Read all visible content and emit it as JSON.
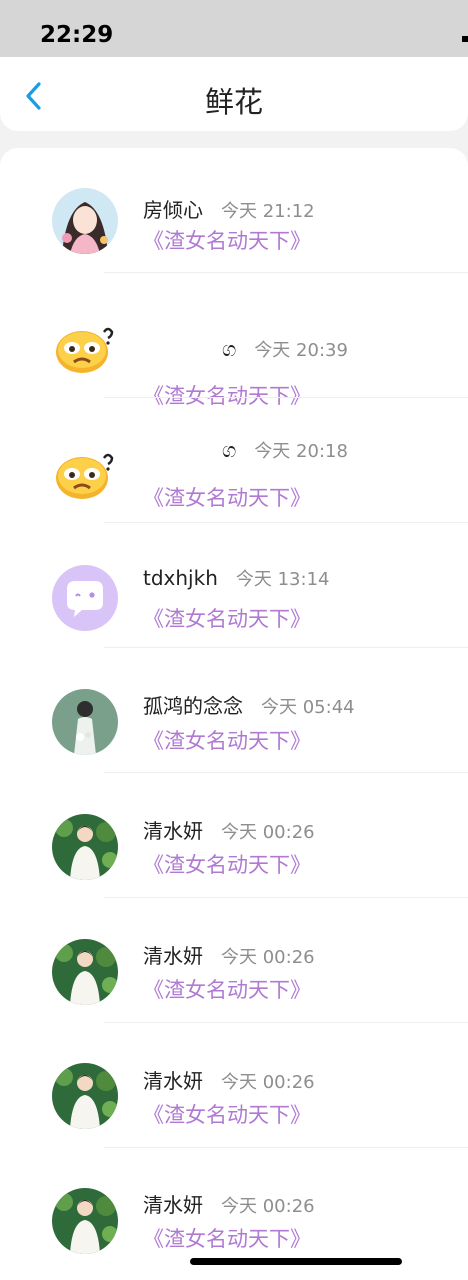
{
  "status": {
    "time": "22:29"
  },
  "nav": {
    "title": "鲜花",
    "back_icon": "chevron-left-icon"
  },
  "list": [
    {
      "name": "房倾心",
      "time": "今天 21:12",
      "book": "《渣女名动天下》",
      "avatar": "girl-illustration"
    },
    {
      "name": "ග",
      "time": "今天 20:39",
      "book": "《渣女名动天下》",
      "avatar": "crying-emoji"
    },
    {
      "name": "ග",
      "time": "今天 20:18",
      "book": "《渣女名动天下》",
      "avatar": "crying-emoji"
    },
    {
      "name": "tdxhjkh",
      "time": "今天 13:14",
      "book": "《渣女名动天下》",
      "avatar": "default-chat-avatar"
    },
    {
      "name": "孤鸿的念念",
      "time": "今天 05:44",
      "book": "《渣女名动天下》",
      "avatar": "bride-photo"
    },
    {
      "name": "清水妍",
      "time": "今天 00:26",
      "book": "《渣女名动天下》",
      "avatar": "man-in-forest"
    },
    {
      "name": "清水妍",
      "time": "今天 00:26",
      "book": "《渣女名动天下》",
      "avatar": "man-in-forest"
    },
    {
      "name": "清水妍",
      "time": "今天 00:26",
      "book": "《渣女名动天下》",
      "avatar": "man-in-forest"
    },
    {
      "name": "清水妍",
      "time": "今天 00:26",
      "book": "《渣女名动天下》",
      "avatar": "man-in-forest"
    }
  ],
  "colors": {
    "accent_blue": "#1a9be6",
    "book_purple": "#b07ad3",
    "time_gray": "#8e8e8e"
  }
}
